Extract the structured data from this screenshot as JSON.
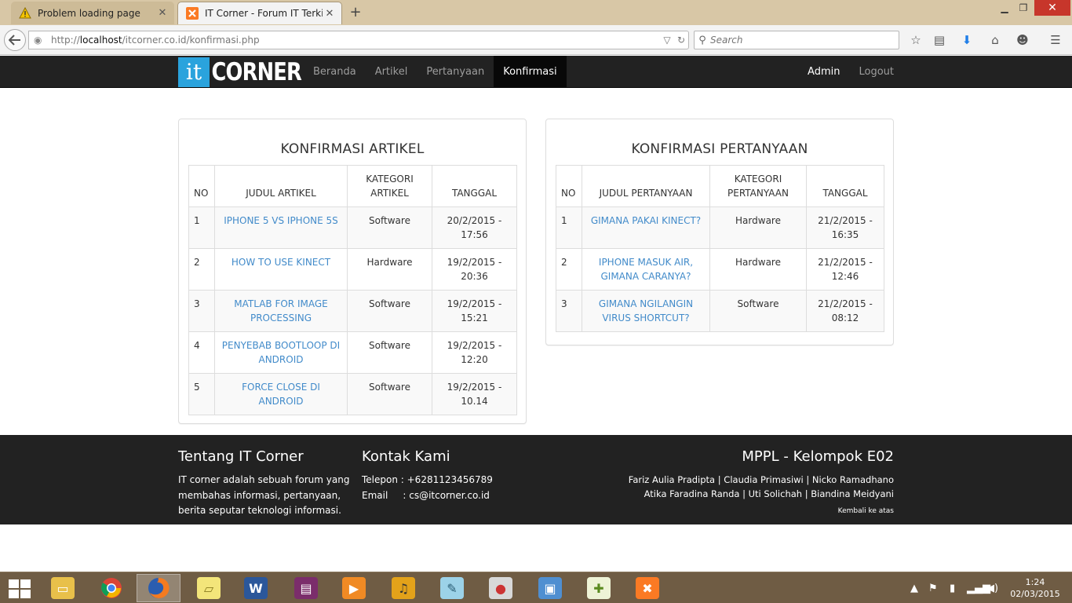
{
  "browser": {
    "tabs": [
      {
        "title": "Problem loading page",
        "active": false,
        "icon": "warning-icon"
      },
      {
        "title": "IT Corner - Forum IT Terkini!",
        "active": true,
        "icon": "xampp-icon"
      }
    ],
    "url_prefix": "http://",
    "url_host": "localhost",
    "url_path": "/itcorner.co.id/konfirmasi.php",
    "search_placeholder": "Search"
  },
  "site": {
    "logo_it": "it",
    "logo_corner": "CORNER",
    "nav": [
      "Beranda",
      "Artikel",
      "Pertanyaan",
      "Konfirmasi"
    ],
    "active_nav": "Konfirmasi",
    "nav_right": [
      "Admin",
      "Logout"
    ]
  },
  "articles": {
    "title": "KONFIRMASI ARTIKEL",
    "headers": [
      "NO",
      "JUDUL ARTIKEL",
      "KATEGORI ARTIKEL",
      "TANGGAL"
    ],
    "rows": [
      {
        "no": "1",
        "title": "IPHONE 5 VS IPHONE 5S",
        "category": "Software",
        "date": "20/2/2015 - 17:56"
      },
      {
        "no": "2",
        "title": "HOW TO USE KINECT",
        "category": "Hardware",
        "date": "19/2/2015 - 20:36"
      },
      {
        "no": "3",
        "title": "MATLAB FOR IMAGE PROCESSING",
        "category": "Software",
        "date": "19/2/2015 - 15:21"
      },
      {
        "no": "4",
        "title": "PENYEBAB BOOTLOOP DI ANDROID",
        "category": "Software",
        "date": "19/2/2015 - 12:20"
      },
      {
        "no": "5",
        "title": "FORCE CLOSE DI ANDROID",
        "category": "Software",
        "date": "19/2/2015 - 10.14"
      }
    ]
  },
  "questions": {
    "title": "KONFIRMASI PERTANYAAN",
    "headers": [
      "NO",
      "JUDUL PERTANYAAN",
      "KATEGORI PERTANYAAN",
      "TANGGAL"
    ],
    "rows": [
      {
        "no": "1",
        "title": "GIMANA PAKAI KINECT?",
        "category": "Hardware",
        "date": "21/2/2015 - 16:35"
      },
      {
        "no": "2",
        "title": "IPHONE MASUK AIR, GIMANA CARANYA?",
        "category": "Hardware",
        "date": "21/2/2015 - 12:46"
      },
      {
        "no": "3",
        "title": "GIMANA NGILANGIN VIRUS SHORTCUT?",
        "category": "Software",
        "date": "21/2/2015 - 08:12"
      }
    ]
  },
  "footer": {
    "about_title": "Tentang IT Corner",
    "about_text": "IT corner adalah sebuah forum yang membahas informasi, pertanyaan, berita seputar teknologi informasi.",
    "contact_title": "Kontak Kami",
    "phone": "Telepon : +6281123456789",
    "email": "Email     : cs@itcorner.co.id",
    "team_title": "MPPL - Kelompok E02",
    "team_line1": "Fariz Aulia Pradipta | Claudia Primasiwi | Nicko Ramadhano",
    "team_line2": "Atika Faradina Randa | Uti Solichah | Biandina Meidyani",
    "back_to_top": "Kembali ke atas"
  },
  "taskbar": {
    "time": "1:24",
    "date": "02/03/2015",
    "apps": [
      "file-explorer",
      "chrome",
      "firefox",
      "sticky-notes",
      "word",
      "winrar",
      "media-player",
      "music-player",
      "notepad",
      "paint",
      "photo-viewer",
      "notepad-plus-plus",
      "xampp"
    ],
    "colors": {
      "taskbar": "#6f5c44",
      "accent_link": "#428bca",
      "dark_bar": "#222222"
    }
  }
}
